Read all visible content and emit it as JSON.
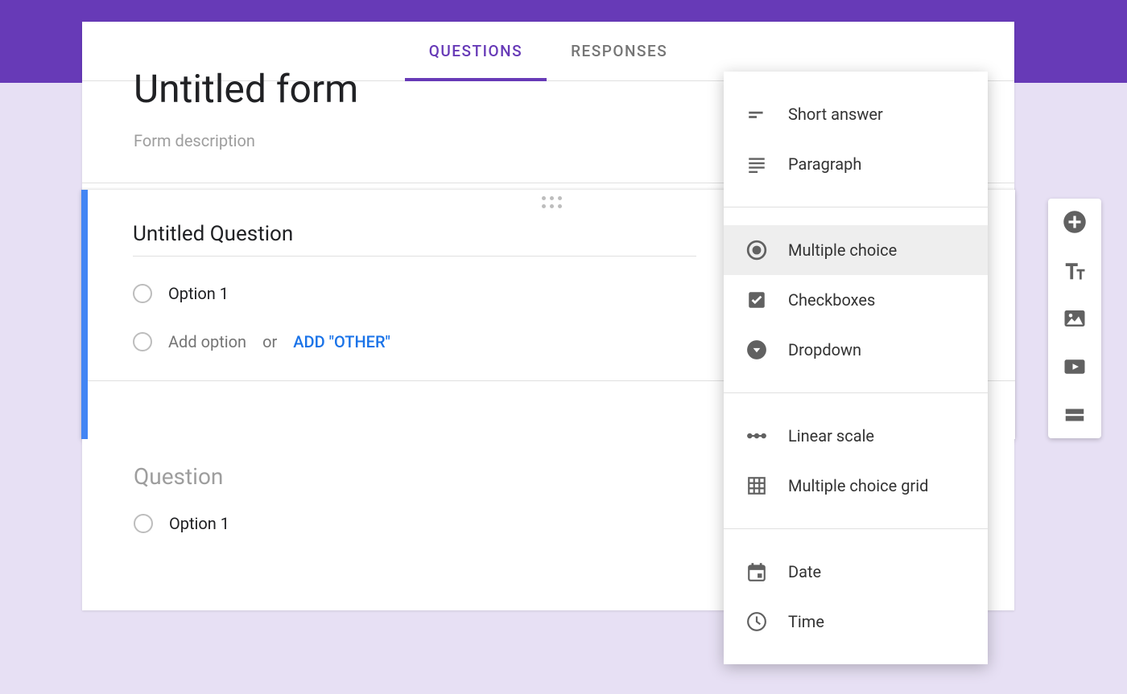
{
  "tabs": {
    "questions": "QUESTIONS",
    "responses": "RESPONSES"
  },
  "form": {
    "title": "Untitled form",
    "description_placeholder": "Form description"
  },
  "active_question": {
    "title": "Untitled Question",
    "option1": "Option 1",
    "add_option": "Add option",
    "or": "or",
    "add_other": "ADD \"OTHER\""
  },
  "inactive_question": {
    "title": "Question",
    "option1": "Option 1"
  },
  "type_menu": {
    "short_answer": "Short answer",
    "paragraph": "Paragraph",
    "multiple_choice": "Multiple choice",
    "checkboxes": "Checkboxes",
    "dropdown": "Dropdown",
    "linear_scale": "Linear scale",
    "multiple_choice_grid": "Multiple choice grid",
    "date": "Date",
    "time": "Time"
  }
}
